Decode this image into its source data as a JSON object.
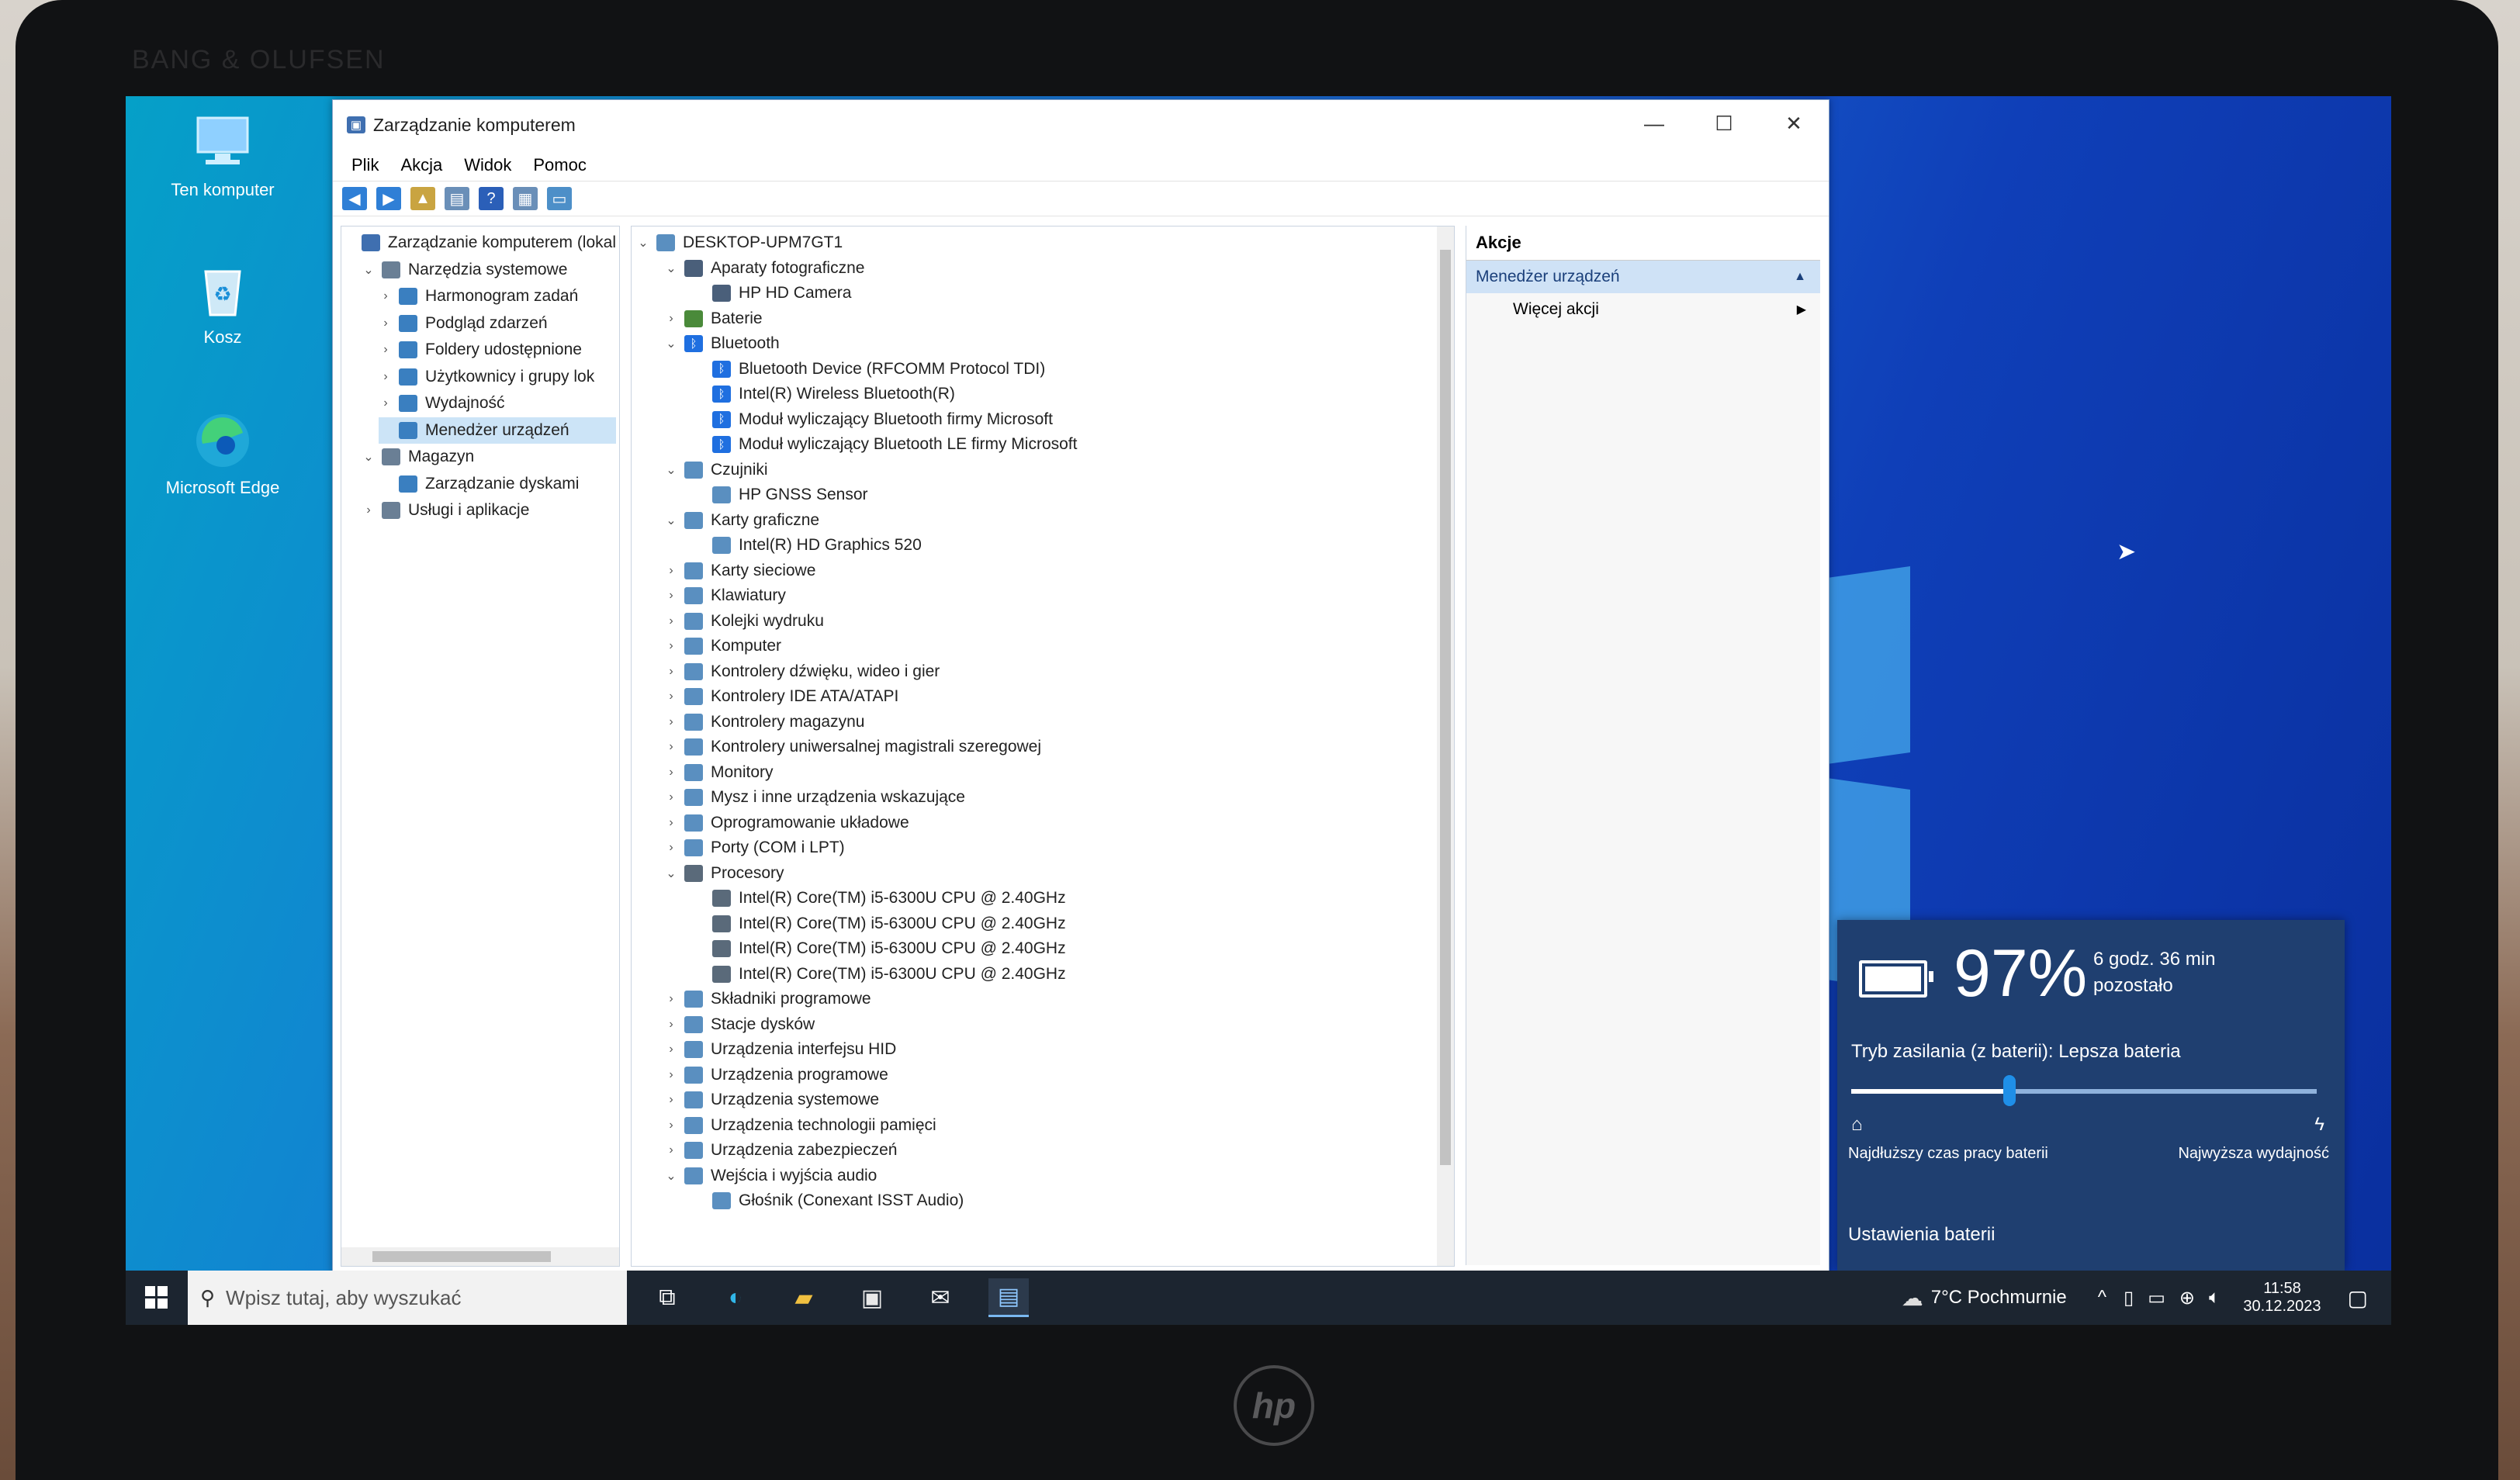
{
  "colors": {
    "accent": "#0078d7",
    "selection": "#cce4f7",
    "flyout_bg": "#1f3f70",
    "taskbar_bg": "#1c2530"
  },
  "bezel": {
    "brand": "BANG & OLUFSEN",
    "logo": "hp"
  },
  "desktop": {
    "icons": [
      {
        "label": "Ten komputer",
        "icon": "computer-icon"
      },
      {
        "label": "Kosz",
        "icon": "recycle-bin-icon"
      },
      {
        "label": "Microsoft Edge",
        "icon": "edge-icon"
      }
    ]
  },
  "window": {
    "title": "Zarządzanie komputerem",
    "menu": [
      "Plik",
      "Akcja",
      "Widok",
      "Pomoc"
    ],
    "toolbar": [
      "back-icon",
      "forward-icon",
      "up-folder-icon",
      "show-hide-console-tree-icon",
      "help-icon",
      "properties-icon",
      "monitor-icon"
    ],
    "left_tree": [
      {
        "label": "Zarządzanie komputerem (lokal",
        "level": 0,
        "expand": ""
      },
      {
        "label": "Narzędzia systemowe",
        "level": 1,
        "expand": "v"
      },
      {
        "label": "Harmonogram zadań",
        "level": 2,
        "expand": ">"
      },
      {
        "label": "Podgląd zdarzeń",
        "level": 2,
        "expand": ">"
      },
      {
        "label": "Foldery udostępnione",
        "level": 2,
        "expand": ">"
      },
      {
        "label": "Użytkownicy i grupy lok",
        "level": 2,
        "expand": ">"
      },
      {
        "label": "Wydajność",
        "level": 2,
        "expand": ">"
      },
      {
        "label": "Menedżer urządzeń",
        "level": 2,
        "expand": "",
        "selected": true
      },
      {
        "label": "Magazyn",
        "level": 1,
        "expand": "v"
      },
      {
        "label": "Zarządzanie dyskami",
        "level": 2,
        "expand": ""
      },
      {
        "label": "Usługi i aplikacje",
        "level": 1,
        "expand": ">"
      }
    ],
    "device_tree": [
      {
        "label": "DESKTOP-UPM7GT1",
        "level": 0,
        "expand": "v",
        "icon": "computer-icon"
      },
      {
        "label": "Aparaty fotograficzne",
        "level": 1,
        "expand": "v",
        "icon": "camera-icon"
      },
      {
        "label": "HP HD Camera",
        "level": 2,
        "expand": "",
        "icon": "camera-icon"
      },
      {
        "label": "Baterie",
        "level": 1,
        "expand": ">",
        "icon": "battery-icon"
      },
      {
        "label": "Bluetooth",
        "level": 1,
        "expand": "v",
        "icon": "bluetooth-icon"
      },
      {
        "label": "Bluetooth Device (RFCOMM Protocol TDI)",
        "level": 2,
        "expand": "",
        "icon": "bluetooth-icon"
      },
      {
        "label": "Intel(R) Wireless Bluetooth(R)",
        "level": 2,
        "expand": "",
        "icon": "bluetooth-icon"
      },
      {
        "label": "Moduł wyliczający Bluetooth firmy Microsoft",
        "level": 2,
        "expand": "",
        "icon": "bluetooth-icon"
      },
      {
        "label": "Moduł wyliczający Bluetooth LE firmy Microsoft",
        "level": 2,
        "expand": "",
        "icon": "bluetooth-icon"
      },
      {
        "label": "Czujniki",
        "level": 1,
        "expand": "v",
        "icon": "sensor-icon"
      },
      {
        "label": "HP GNSS Sensor",
        "level": 2,
        "expand": "",
        "icon": "sensor-icon"
      },
      {
        "label": "Karty graficzne",
        "level": 1,
        "expand": "v",
        "icon": "display-adapter-icon"
      },
      {
        "label": "Intel(R) HD Graphics 520",
        "level": 2,
        "expand": "",
        "icon": "display-adapter-icon"
      },
      {
        "label": "Karty sieciowe",
        "level": 1,
        "expand": ">",
        "icon": "network-adapter-icon"
      },
      {
        "label": "Klawiatury",
        "level": 1,
        "expand": ">",
        "icon": "keyboard-icon"
      },
      {
        "label": "Kolejki wydruku",
        "level": 1,
        "expand": ">",
        "icon": "printer-icon"
      },
      {
        "label": "Komputer",
        "level": 1,
        "expand": ">",
        "icon": "computer-icon"
      },
      {
        "label": "Kontrolery dźwięku, wideo i gier",
        "level": 1,
        "expand": ">",
        "icon": "sound-icon"
      },
      {
        "label": "Kontrolery IDE ATA/ATAPI",
        "level": 1,
        "expand": ">",
        "icon": "ide-icon"
      },
      {
        "label": "Kontrolery magazynu",
        "level": 1,
        "expand": ">",
        "icon": "storage-icon"
      },
      {
        "label": "Kontrolery uniwersalnej magistrali szeregowej",
        "level": 1,
        "expand": ">",
        "icon": "usb-icon"
      },
      {
        "label": "Monitory",
        "level": 1,
        "expand": ">",
        "icon": "monitor-icon"
      },
      {
        "label": "Mysz i inne urządzenia wskazujące",
        "level": 1,
        "expand": ">",
        "icon": "mouse-icon"
      },
      {
        "label": "Oprogramowanie układowe",
        "level": 1,
        "expand": ">",
        "icon": "firmware-icon"
      },
      {
        "label": "Porty (COM i LPT)",
        "level": 1,
        "expand": ">",
        "icon": "port-icon"
      },
      {
        "label": "Procesory",
        "level": 1,
        "expand": "v",
        "icon": "processor-icon"
      },
      {
        "label": "Intel(R) Core(TM) i5-6300U CPU @ 2.40GHz",
        "level": 2,
        "expand": "",
        "icon": "processor-icon"
      },
      {
        "label": "Intel(R) Core(TM) i5-6300U CPU @ 2.40GHz",
        "level": 2,
        "expand": "",
        "icon": "processor-icon"
      },
      {
        "label": "Intel(R) Core(TM) i5-6300U CPU @ 2.40GHz",
        "level": 2,
        "expand": "",
        "icon": "processor-icon"
      },
      {
        "label": "Intel(R) Core(TM) i5-6300U CPU @ 2.40GHz",
        "level": 2,
        "expand": "",
        "icon": "processor-icon"
      },
      {
        "label": "Składniki programowe",
        "level": 1,
        "expand": ">",
        "icon": "software-component-icon"
      },
      {
        "label": "Stacje dysków",
        "level": 1,
        "expand": ">",
        "icon": "disk-drive-icon"
      },
      {
        "label": "Urządzenia interfejsu HID",
        "level": 1,
        "expand": ">",
        "icon": "hid-icon"
      },
      {
        "label": "Urządzenia programowe",
        "level": 1,
        "expand": ">",
        "icon": "software-device-icon"
      },
      {
        "label": "Urządzenia systemowe",
        "level": 1,
        "expand": ">",
        "icon": "system-device-icon"
      },
      {
        "label": "Urządzenia technologii pamięci",
        "level": 1,
        "expand": ">",
        "icon": "memory-tech-icon"
      },
      {
        "label": "Urządzenia zabezpieczeń",
        "level": 1,
        "expand": ">",
        "icon": "security-device-icon"
      },
      {
        "label": "Wejścia i wyjścia audio",
        "level": 1,
        "expand": "v",
        "icon": "audio-io-icon"
      },
      {
        "label": "Głośnik (Conexant ISST Audio)",
        "level": 2,
        "expand": "",
        "icon": "speaker-icon"
      }
    ],
    "actions": {
      "header": "Akcje",
      "section": "Menedżer urządzeń",
      "more": "Więcej akcji"
    }
  },
  "taskbar": {
    "search_placeholder": "Wpisz tutaj, aby wyszukać",
    "pinned": [
      "task-view-icon",
      "edge-icon",
      "file-explorer-icon",
      "store-icon",
      "mail-icon",
      "computer-management-icon"
    ],
    "weather": "7°C Pochmurnie",
    "time": "11:58",
    "date": "30.12.2023"
  },
  "battery_flyout": {
    "percent": "97%",
    "remaining_line1": "6 godz. 36 min",
    "remaining_line2": "pozostało",
    "mode_label": "Tryb zasilania (z baterii): Lepsza bateria",
    "slider_value": 0.34,
    "left_label": "Najdłuższy czas pracy baterii",
    "right_label": "Najwyższa wydajność",
    "settings_link": "Ustawienia baterii"
  }
}
